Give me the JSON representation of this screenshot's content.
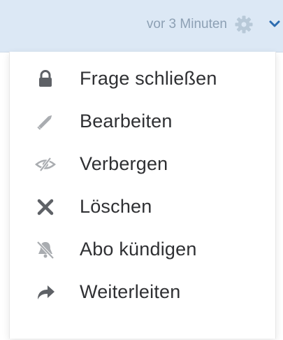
{
  "header": {
    "timestamp": "vor 3 Minuten",
    "settings_icon": "gear-icon",
    "dropdown_icon": "chevron-down-icon"
  },
  "menu": {
    "items": [
      {
        "label": "Frage schließen",
        "icon": "lock-icon"
      },
      {
        "label": "Bearbeiten",
        "icon": "pencil-icon"
      },
      {
        "label": "Verbergen",
        "icon": "eye-slash-icon"
      },
      {
        "label": "Löschen",
        "icon": "times-icon"
      },
      {
        "label": "Abo kündigen",
        "icon": "bell-slash-icon"
      },
      {
        "label": "Weiterleiten",
        "icon": "share-arrow-icon"
      }
    ]
  },
  "colors": {
    "header_bg": "#dce8f5",
    "timestamp": "#8da0b4",
    "gear": "#b8c9d8",
    "chevron": "#2c6cb0",
    "label": "#2f3033",
    "icon_dark": "#5e6166",
    "icon_light": "#a9acb0"
  }
}
